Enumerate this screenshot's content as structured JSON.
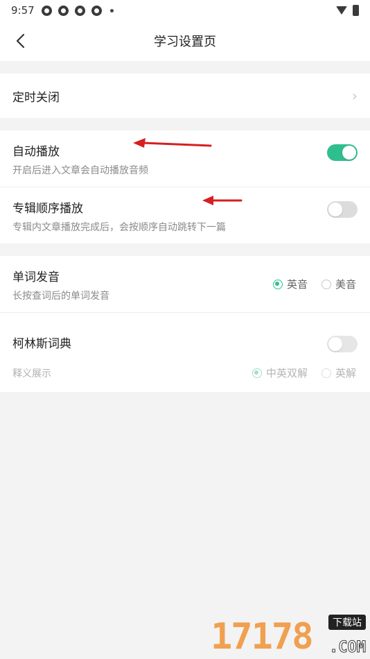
{
  "status_bar": {
    "time": "9:57"
  },
  "header": {
    "title": "学习设置页"
  },
  "timer": {
    "label": "定时关闭"
  },
  "auto_play": {
    "title": "自动播放",
    "subtitle": "开启后进入文章会自动播放音频",
    "enabled": true
  },
  "album_play": {
    "title": "专辑顺序播放",
    "subtitle": "专辑内文章播放完成后，会按顺序自动跳转下一篇",
    "enabled": false
  },
  "word_pron": {
    "title": "单词发音",
    "subtitle": "长按查词后的单词发音",
    "options": [
      "英音",
      "美音"
    ],
    "selected": "英音"
  },
  "collins": {
    "title": "柯林斯词典",
    "enabled": false,
    "sub_label": "释义展示",
    "options": [
      "中英双解",
      "英解"
    ],
    "selected": "中英双解"
  },
  "watermark": {
    "digits": "17178",
    "tag": "下载站",
    "domain": ".COM"
  },
  "colors": {
    "accent": "#2fbf8f",
    "annotation_arrow": "#d61f1f"
  }
}
